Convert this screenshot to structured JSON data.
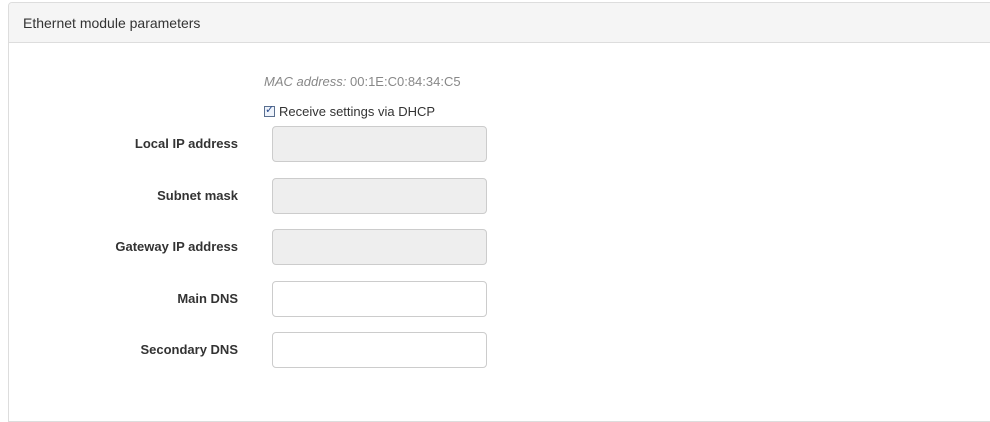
{
  "panel": {
    "title": "Ethernet module parameters"
  },
  "mac": {
    "label": "MAC address:",
    "value": "00:1E:C0:84:34:C5"
  },
  "dhcp": {
    "label": "Receive settings via DHCP",
    "checked": true
  },
  "fields": [
    {
      "label": "Local IP address",
      "value": "",
      "disabled": true
    },
    {
      "label": "Subnet mask",
      "value": "",
      "disabled": true
    },
    {
      "label": "Gateway IP address",
      "value": "",
      "disabled": true
    },
    {
      "label": "Main DNS",
      "value": "",
      "disabled": false
    },
    {
      "label": "Secondary DNS",
      "value": "",
      "disabled": false
    }
  ],
  "colors": {
    "heading_bg": "#f5f5f5",
    "border": "#dddddd",
    "disabled_input_bg": "#eeeeee",
    "muted_text": "#888888"
  }
}
